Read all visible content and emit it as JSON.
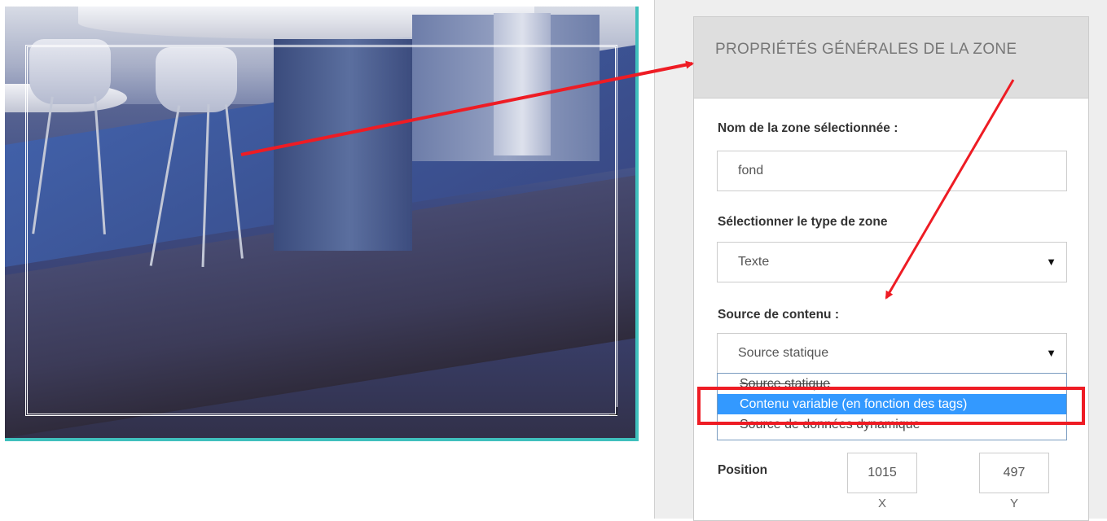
{
  "panel": {
    "title": "PROPRIÉTÉS GÉNÉRALES DE LA ZONE",
    "zone_name": {
      "label": "Nom de la zone sélectionnée :",
      "value": "fond"
    },
    "zone_type": {
      "label": "Sélectionner le type de zone",
      "selected": "Texte"
    },
    "content_source": {
      "label": "Source de contenu :",
      "selected": "Source statique",
      "options": [
        "Source statique",
        "Contenu variable (en fonction des tags)",
        "Source de données dynamique"
      ],
      "highlighted_index": 1
    },
    "position": {
      "label": "Position",
      "x_value": "1015",
      "y_value": "497",
      "x_label": "X",
      "y_label": "Y"
    }
  },
  "icons": {
    "dropdown_caret": "▼",
    "resize_handle": "resize-grip-icon"
  },
  "colors": {
    "selection_border": "#ffffff",
    "canvas_frame": "#3fc0bd",
    "annotation_red": "#ee1c24",
    "option_highlight": "#3399ff"
  }
}
